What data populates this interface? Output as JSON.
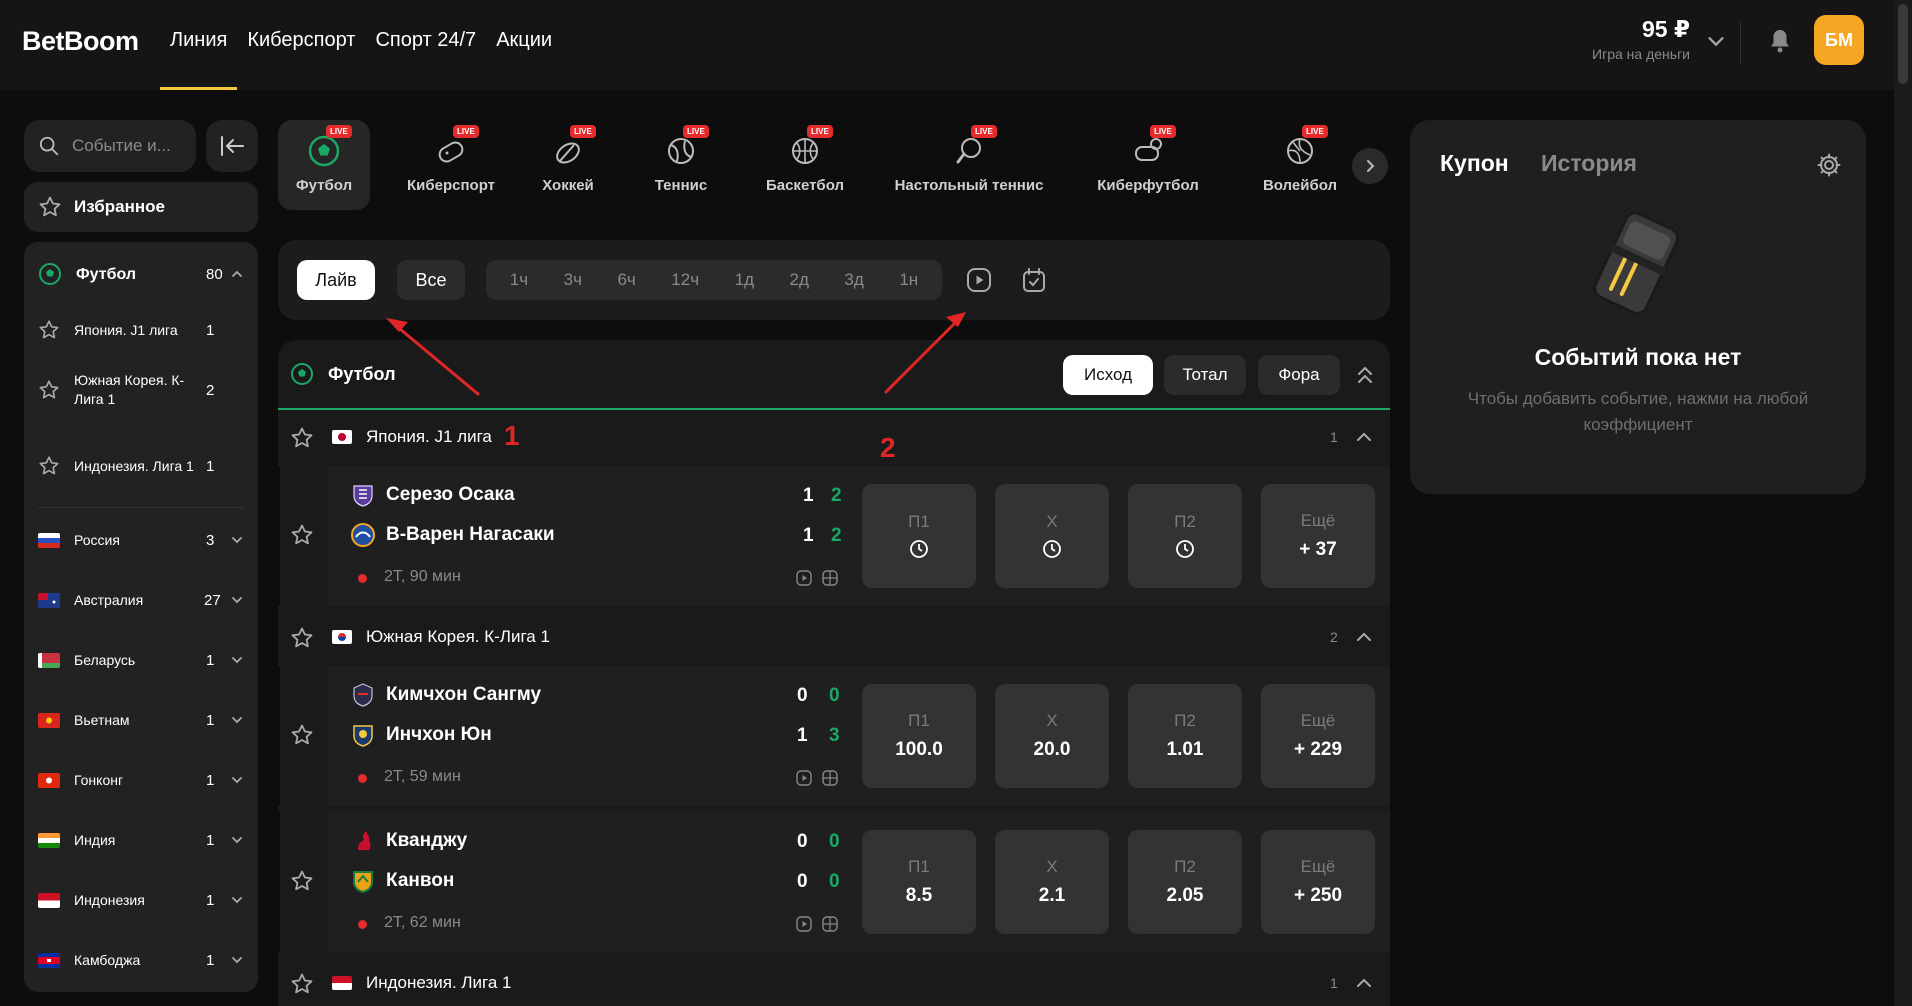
{
  "header": {
    "logo": "BetBoom",
    "nav": [
      "Линия",
      "Киберспорт",
      "Спорт 24/7",
      "Акции"
    ],
    "balance": "95 ₽",
    "balance_label": "Игра на деньги",
    "avatar": "БМ"
  },
  "sidebar": {
    "search_placeholder": "Событие и...",
    "favorites": "Избранное",
    "sport": {
      "label": "Футбол",
      "count": "80"
    },
    "leagues": [
      {
        "label": "Япония. J1 лига",
        "count": "1"
      },
      {
        "label": "Южная Корея. К-Лига 1",
        "count": "2"
      },
      {
        "label": "Индонезия. Лига 1",
        "count": "1"
      }
    ],
    "countries": [
      {
        "label": "Россия",
        "count": "3"
      },
      {
        "label": "Австралия",
        "count": "27"
      },
      {
        "label": "Беларусь",
        "count": "1"
      },
      {
        "label": "Вьетнам",
        "count": "1"
      },
      {
        "label": "Гонконг",
        "count": "1"
      },
      {
        "label": "Индия",
        "count": "1"
      },
      {
        "label": "Индонезия",
        "count": "1"
      },
      {
        "label": "Камбоджа",
        "count": "1"
      }
    ]
  },
  "sports_tabs": {
    "live_badge": "LIVE",
    "items": [
      "Футбол",
      "Киберспорт",
      "Хоккей",
      "Теннис",
      "Баскетбол",
      "Настольный теннис",
      "Киберфутбол",
      "Волейбол"
    ]
  },
  "filters": {
    "live": "Лайв",
    "all": "Все",
    "times": [
      "1ч",
      "3ч",
      "6ч",
      "12ч",
      "1д",
      "2д",
      "3д",
      "1н"
    ]
  },
  "events": {
    "title": "Футбол",
    "markets": [
      "Исход",
      "Тотал",
      "Фора"
    ],
    "odd_labels": [
      "П1",
      "Х",
      "П2",
      "Ещё"
    ],
    "leagues": [
      {
        "name": "Япония. J1 лига",
        "count": "1",
        "matches": [
          {
            "team1": "Серезо Осака",
            "team2": "В-Варен Нагасаки",
            "s1": "1",
            "s1g": "2",
            "s2": "1",
            "s2g": "2",
            "time": "2Т, 90 мин",
            "odds": [
              "",
              "",
              ""
            ],
            "more": "+ 37"
          }
        ]
      },
      {
        "name": "Южная Корея. К-Лига 1",
        "count": "2",
        "matches": [
          {
            "team1": "Кимчхон Сангму",
            "team2": "Инчхон Юн",
            "s1": "0",
            "s1g": "0",
            "s2": "1",
            "s2g": "3",
            "time": "2Т, 59 мин",
            "odds": [
              "100.0",
              "20.0",
              "1.01"
            ],
            "more": "+ 229"
          },
          {
            "team1": "Кванджу",
            "team2": "Канвон",
            "s1": "0",
            "s1g": "0",
            "s2": "0",
            "s2g": "0",
            "time": "2Т, 62 мин",
            "odds": [
              "8.5",
              "2.1",
              "2.05"
            ],
            "more": "+ 250"
          }
        ]
      },
      {
        "name": "Индонезия. Лига 1",
        "count": "1",
        "matches": []
      }
    ]
  },
  "coupon": {
    "tab_coupon": "Купон",
    "tab_history": "История",
    "empty_title": "Событий пока нет",
    "empty_sub": "Чтобы добавить событие, нажми на любой коэффициент"
  },
  "annotations": {
    "label1": "1",
    "label2": "2"
  },
  "colors": {
    "accent_green": "#19a866",
    "accent_yellow": "#f5c842",
    "live_red": "#e52b2b",
    "avatar_orange": "#f5a623"
  }
}
